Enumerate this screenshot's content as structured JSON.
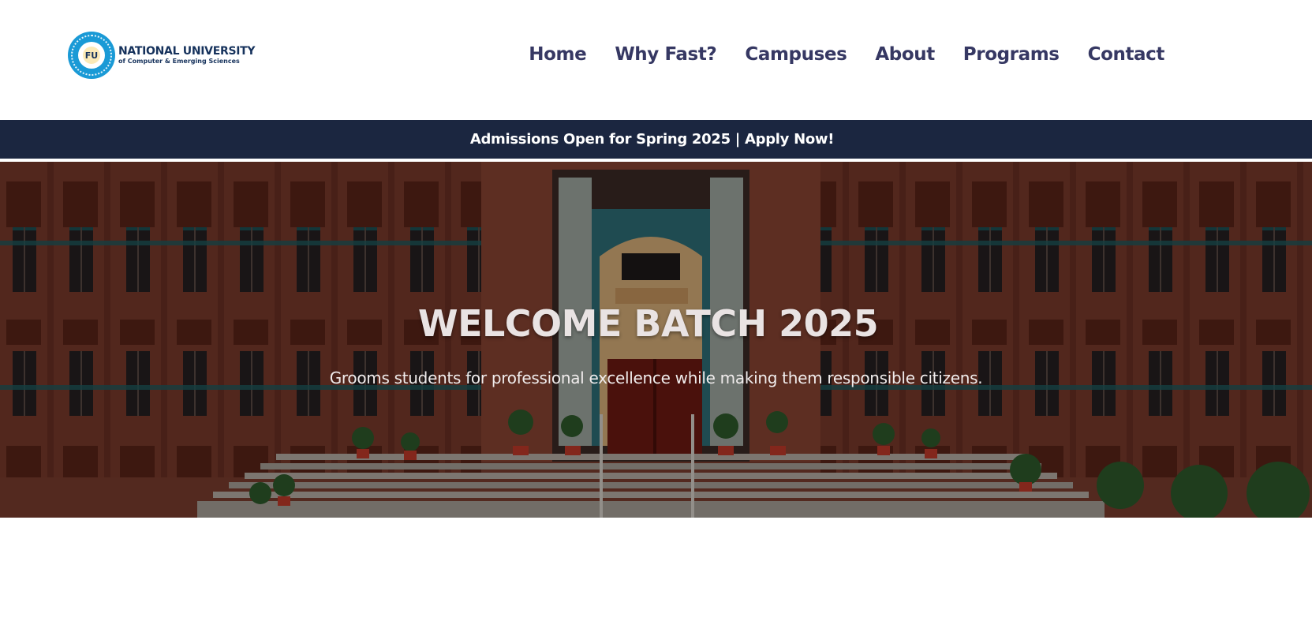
{
  "logo": {
    "title": "NATIONAL UNIVERSITY",
    "subtitle": "of Computer & Emerging Sciences",
    "seal_letters": "FU"
  },
  "nav": {
    "items": [
      {
        "label": "Home"
      },
      {
        "label": "Why Fast?"
      },
      {
        "label": "Campuses"
      },
      {
        "label": "About"
      },
      {
        "label": "Programs"
      },
      {
        "label": "Contact"
      }
    ]
  },
  "banner": {
    "text": "Admissions Open for Spring 2025 | Apply Now!"
  },
  "hero": {
    "title": "WELCOME BATCH 2025",
    "subtitle": "Grooms students for professional excellence while making them responsible citizens."
  },
  "colors": {
    "nav_text": "#363863",
    "banner_bg": "#1b2640",
    "brand_blue": "#1a9ad6"
  }
}
